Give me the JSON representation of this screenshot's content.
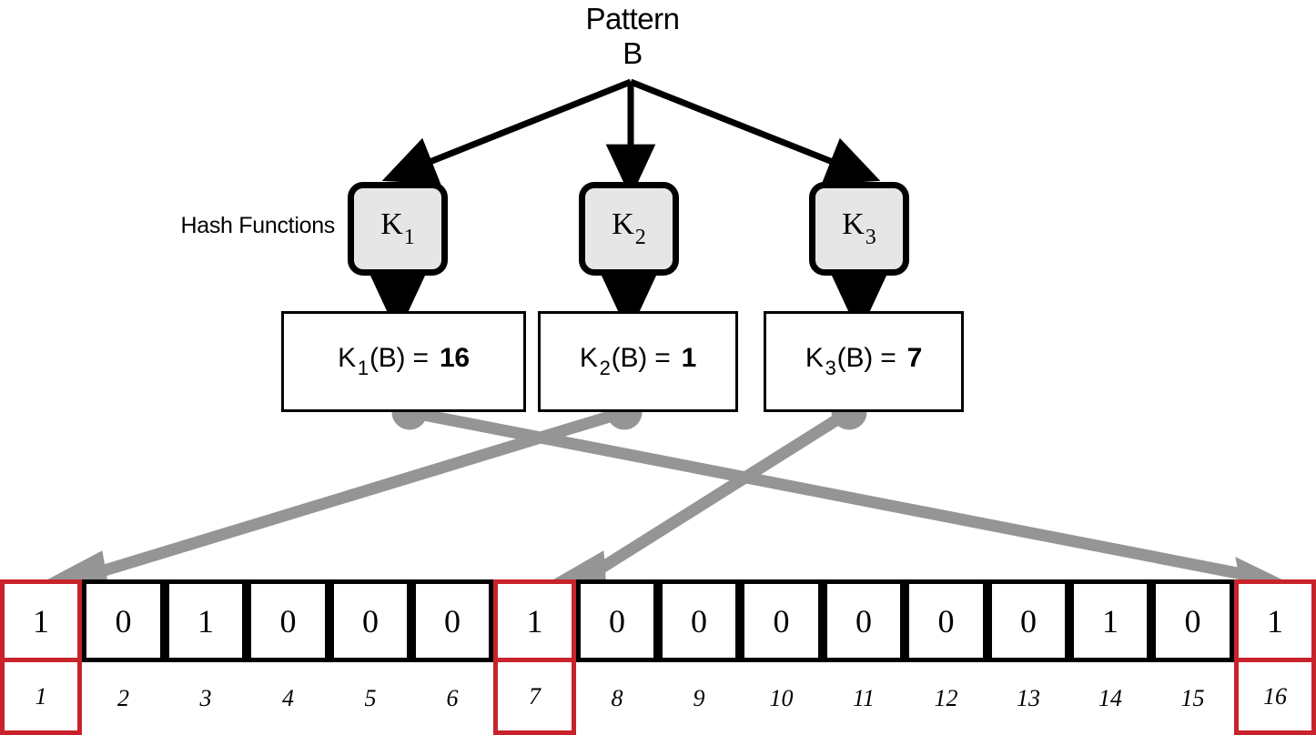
{
  "diagram": {
    "title_line1": "Pattern",
    "title_line2": "B",
    "hash_functions_label": "Hash Functions",
    "accent_red": "#c8232c",
    "connector_gray": "#959595",
    "hash_box_fill": "#e6e6e6"
  },
  "hash_functions": [
    {
      "name": "K",
      "subscript": "1"
    },
    {
      "name": "K",
      "subscript": "2"
    },
    {
      "name": "K",
      "subscript": "3"
    }
  ],
  "hash_values": [
    {
      "fn": "K",
      "subscript": "1",
      "arg": "(B)",
      "equals": "=",
      "result": "16"
    },
    {
      "fn": "K",
      "subscript": "2",
      "arg": "(B)",
      "equals": "=",
      "result": "1"
    },
    {
      "fn": "K",
      "subscript": "3",
      "arg": "(B)",
      "equals": "=",
      "result": "7"
    }
  ],
  "bit_array": {
    "size": 16,
    "bits": [
      "1",
      "0",
      "1",
      "0",
      "0",
      "0",
      "1",
      "0",
      "0",
      "0",
      "0",
      "0",
      "0",
      "1",
      "0",
      "1"
    ],
    "indices": [
      "1",
      "2",
      "3",
      "4",
      "5",
      "6",
      "7",
      "8",
      "9",
      "10",
      "11",
      "12",
      "13",
      "14",
      "15",
      "16"
    ],
    "highlighted_indices": [
      1,
      7,
      16
    ]
  },
  "mappings": [
    {
      "from": "K1(B)",
      "to_index": 16
    },
    {
      "from": "K2(B)",
      "to_index": 1
    },
    {
      "from": "K3(B)",
      "to_index": 7
    }
  ]
}
